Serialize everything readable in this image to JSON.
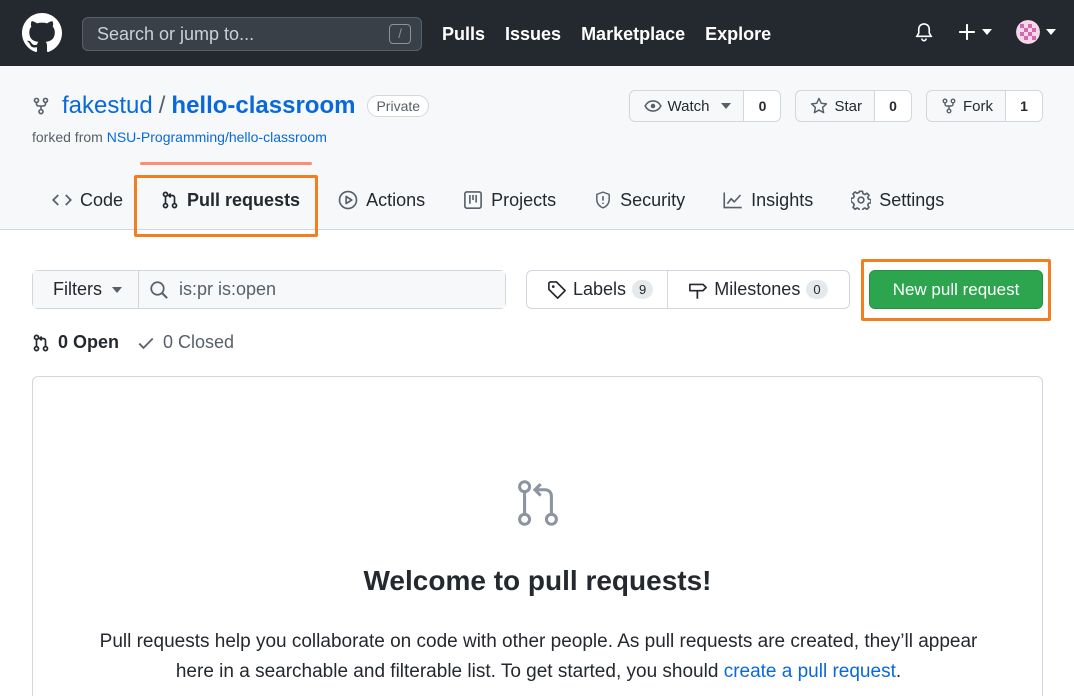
{
  "header": {
    "search_placeholder": "Search or jump to...",
    "search_shortcut": "/",
    "nav": [
      "Pulls",
      "Issues",
      "Marketplace",
      "Explore"
    ]
  },
  "repo": {
    "owner": "fakestud",
    "separator": "/",
    "name": "hello-classroom",
    "visibility": "Private",
    "forked_prefix": "forked from",
    "forked_from": "NSU-Programming/hello-classroom",
    "watch_label": "Watch",
    "watch_count": "0",
    "star_label": "Star",
    "star_count": "0",
    "fork_label": "Fork",
    "fork_count": "1"
  },
  "tabs": [
    {
      "label": "Code",
      "icon": "code-icon"
    },
    {
      "label": "Pull requests",
      "icon": "git-pull-request-icon",
      "selected": true
    },
    {
      "label": "Actions",
      "icon": "play-icon"
    },
    {
      "label": "Projects",
      "icon": "table-icon"
    },
    {
      "label": "Security",
      "icon": "shield-icon"
    },
    {
      "label": "Insights",
      "icon": "graph-icon"
    },
    {
      "label": "Settings",
      "icon": "gear-icon"
    }
  ],
  "subnav": {
    "filters_label": "Filters",
    "query": "is:pr is:open",
    "labels_label": "Labels",
    "labels_count": "9",
    "milestones_label": "Milestones",
    "milestones_count": "0",
    "new_pr_label": "New pull request"
  },
  "states": {
    "open_label": "0 Open",
    "closed_label": "0 Closed"
  },
  "blankslate": {
    "title": "Welcome to pull requests!",
    "text": "Pull requests help you collaborate on code with other people. As pull requests are created, they’ll appear here in a searchable and filterable list. To get started, you should",
    "link": "create a pull request",
    "end": "."
  },
  "colors": {
    "header_bg": "#24292f",
    "link": "#0969da",
    "primary_button": "#2da44e",
    "highlight_box": "#f37e20",
    "selected_tab_underline": "#fd8c73"
  }
}
